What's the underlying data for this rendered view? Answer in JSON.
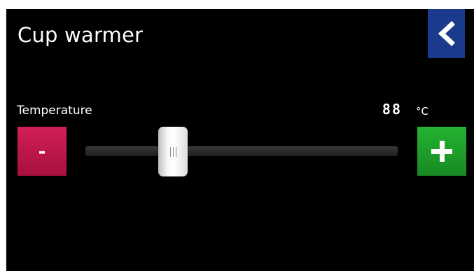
{
  "header": {
    "title": "Cup warmer",
    "back_button_color": "#1a3a8c",
    "back_icon": "chevron-left-icon"
  },
  "temperature": {
    "label": "Temperature",
    "value": "88",
    "unit": "°C",
    "slider_fraction": 0.28
  },
  "controls": {
    "minus_label": "-",
    "minus_color": "#c0174a",
    "plus_icon": "plus-icon",
    "plus_color": "#1f9e2b"
  }
}
